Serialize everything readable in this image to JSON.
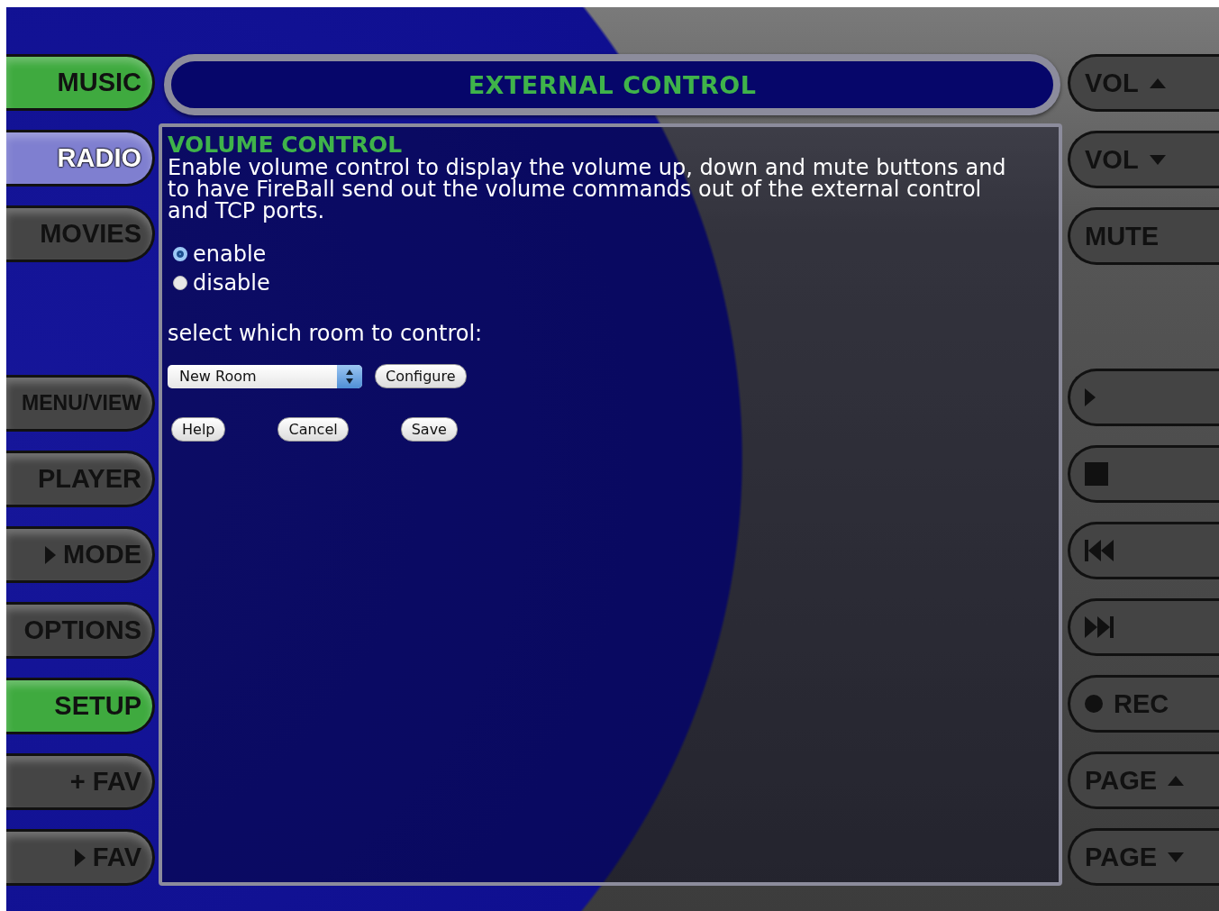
{
  "sidebar": {
    "top_items": [
      {
        "label": "MUSIC",
        "color": "#3faa3f",
        "selected": false
      },
      {
        "label": "RADIO",
        "color": "#7f7fd0",
        "selected": true
      },
      {
        "label": "MOVIES",
        "color": "#454545",
        "selected": false
      }
    ],
    "bottom_items": [
      {
        "label": "MENU/VIEW",
        "color": "#454545",
        "selected": false
      },
      {
        "label": "PLAYER",
        "color": "#454545",
        "selected": false
      },
      {
        "label": "MODE",
        "color": "#454545",
        "selected": false,
        "kind": "play"
      },
      {
        "label": "OPTIONS",
        "color": "#454545",
        "selected": false
      },
      {
        "label": "SETUP",
        "color": "#3faa3f",
        "selected": false
      },
      {
        "label": "+ FAV",
        "color": "#454545",
        "selected": false
      },
      {
        "label": "FAV",
        "color": "#454545",
        "selected": false,
        "kind": "play"
      }
    ]
  },
  "title": "EXTERNAL CONTROL",
  "panel": {
    "heading": "VOLUME CONTROL",
    "description": "Enable volume control to display the volume up, down and mute buttons and to have FireBall send out the volume commands out of the external control and TCP ports.",
    "options": [
      {
        "label": "enable",
        "selected": true
      },
      {
        "label": "disable",
        "selected": false
      }
    ],
    "room_label": "select which room to control:",
    "room_select": {
      "value": "New Room"
    },
    "configure_button": "Configure",
    "buttons": [
      "Help",
      "Cancel",
      "Save"
    ]
  },
  "transport": {
    "top_items": [
      {
        "label": "VOL",
        "kind": "up"
      },
      {
        "label": "VOL",
        "kind": "down"
      },
      {
        "label": "MUTE",
        "kind": "text"
      }
    ],
    "bottom_items": [
      {
        "kind": "play"
      },
      {
        "kind": "stop"
      },
      {
        "kind": "prev"
      },
      {
        "kind": "next"
      },
      {
        "label": "REC",
        "kind": "record"
      },
      {
        "label": "PAGE",
        "kind": "up"
      },
      {
        "label": "PAGE",
        "kind": "down"
      }
    ]
  }
}
